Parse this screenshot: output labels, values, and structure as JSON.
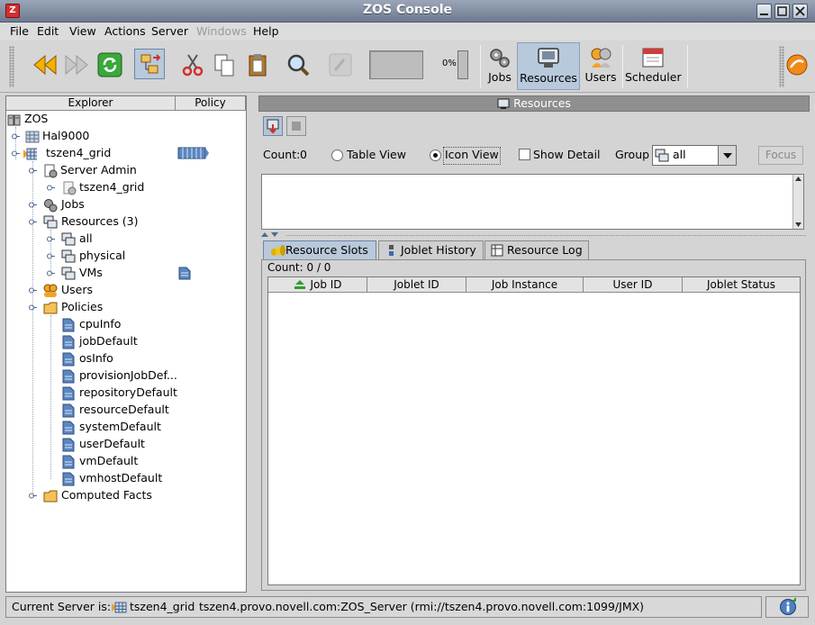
{
  "window": {
    "title": "ZOS Console",
    "app_icon": "Z"
  },
  "menu": [
    "File",
    "Edit",
    "View",
    "Actions",
    "Server",
    "Windows",
    "Help"
  ],
  "toolbar": {
    "progress_text": "0%",
    "progress_value": 0,
    "jobs_label": "Jobs",
    "resources_label": "Resources",
    "users_label": "Users",
    "scheduler_label": "Scheduler"
  },
  "explorer": {
    "col_explorer": "Explorer",
    "col_policy": "Policy",
    "tree": {
      "root": "ZOS",
      "hal": "Hal9000",
      "grid": "tszen4_grid",
      "server_admin": "Server Admin",
      "server_admin_child": "tszen4_grid",
      "jobs": "Jobs",
      "resources": "Resources (3)",
      "res_all": "all",
      "res_physical": "physical",
      "res_vms": "VMs",
      "users": "Users",
      "policies": "Policies",
      "policy_items": [
        "cpuInfo",
        "jobDefault",
        "osInfo",
        "provisionJobDef...",
        "repositoryDefault",
        "resourceDefault",
        "systemDefault",
        "userDefault",
        "vmDefault",
        "vmhostDefault"
      ],
      "computed_facts": "Computed Facts"
    }
  },
  "resources_panel": {
    "header": "Resources",
    "count_label": "Count:",
    "count_value": "0",
    "table_view": "Table View",
    "icon_view": "Icon View",
    "show_detail": "Show Detail",
    "group_label": "Group",
    "group_value": "all",
    "focus_label": "Focus"
  },
  "tabs": [
    "Resource Slots",
    "Joblet History",
    "Resource Log"
  ],
  "slots": {
    "count_text": "Count:  0 / 0",
    "columns": [
      "Job ID",
      "Joblet ID",
      "Job Instance",
      "User ID",
      "Joblet Status"
    ]
  },
  "status": {
    "label": "Current Server is:",
    "server": "tszen4_grid",
    "detail": "tszen4.provo.novell.com:ZOS_Server (rmi://tszen4.provo.novell.com:1099/JMX)"
  }
}
